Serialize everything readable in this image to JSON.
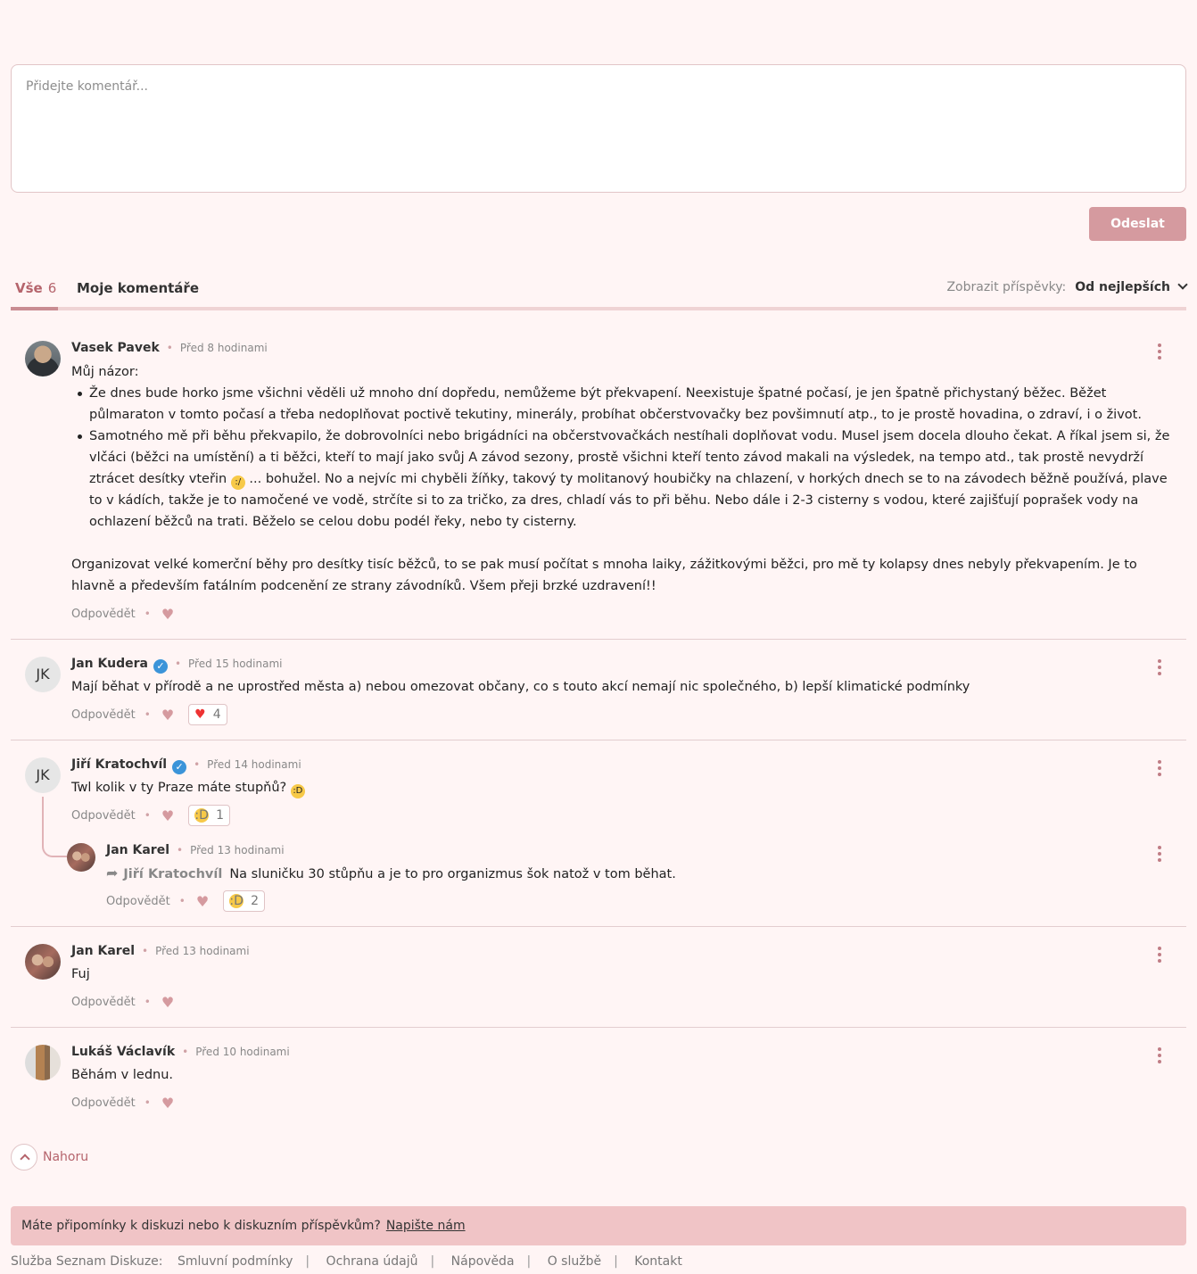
{
  "composer": {
    "placeholder": "Přidejte komentář..."
  },
  "send_label": "Odeslat",
  "tabs": {
    "all_label": "Vše",
    "all_count": "6",
    "mine_label": "Moje komentáře",
    "sort_label": "Zobrazit příspěvky:",
    "sort_value": "Od nejlepších"
  },
  "comments": [
    {
      "author": "Vasek Pavek",
      "time": "Před 8 hodinami",
      "intro": "Můj názor:",
      "bullets": [
        "Že dnes bude horko jsme všichni věděli už mnoho dní dopředu, nemůžeme být překvapení. Neexistuje špatné počasí, je jen špatně přichystaný běžec. Běžet půlmaraton v tomto počasí a třeba nedoplňovat poctivě tekutiny, minerály, probíhat občerstvovačky bez povšimnutí atp., to je prostě hovadina, o zdraví, i o život.",
        "Samotného mě při běhu překvapilo, že dobrovolníci nebo brigádníci na občerstvovačkách nestíhali doplňovat vodu. Musel jsem docela dlouho čekat. A říkal jsem si, že vlčáci (běžci na umístění) a ti běžci, kteří to mají jako svůj A závod sezony, prostě všichni kteří tento závod makali na výsledek, na tempo atd., tak prostě nevydrží ztrácet desítky vteřin",
        "... bohužel. No a nejvíc mi chyběli žíňky, takový ty molitanový houbičky na chlazení, v horkých dnech se to na závodech běžně používá, plave to v kádích, takže je to namočené ve vodě, strčíte si to za tričko, za dres, chladí vás to při běhu. Nebo dále i 2-3 cisterny s vodou, které zajišťují poprašek vody na ochlazení běžců na trati. Běželo se celou dobu podél řeky, nebo ty cisterny."
      ],
      "outro": "Organizovat velké komerční běhy pro desítky tisíc běžců, to se pak musí počítat s mnoha laiky, zážitkovými běžci, pro mě ty kolapsy dnes nebyly překvapením. Je to hlavně a především fatálním podcenění ze strany závodníků. Všem přeji brzké uzdravení!!",
      "reply": "Odpovědět"
    },
    {
      "author": "Jan Kudera",
      "initials": "JK",
      "time": "Před 15 hodinami",
      "text": "Mají běhat v přírodě a ne uprostřed města a) nebou omezovat občany, co s touto akcí nemají nic společného, b) lepší klimatické podmínky",
      "reply": "Odpovědět",
      "reaction_count": "4"
    },
    {
      "author": "Jiří Kratochvíl",
      "initials": "JK",
      "time": "Před 14 hodinami",
      "text": "Twl kolik v ty Praze máte stupňů?",
      "reply": "Odpovědět",
      "reaction_count": "1"
    },
    {
      "author": "Jan Karel",
      "time": "Před 13 hodinami",
      "reply_to": "Jiří Kratochvíl",
      "text": "Na sluničku 30 stůpňu a je to pro organizmus šok natož v tom běhat.",
      "reply": "Odpovědět",
      "reaction_count": "2"
    },
    {
      "author": "Jan Karel",
      "time": "Před 13 hodinami",
      "text": "Fuj",
      "reply": "Odpovědět"
    },
    {
      "author": "Lukáš Václavík",
      "time": "Před 10 hodinami",
      "text": "Běhám v lednu.",
      "reply": "Odpovědět"
    }
  ],
  "top_label": "Nahoru",
  "feedback": {
    "text": "Máte připomínky k diskuzi nebo k diskuzním příspěvkům?",
    "link": "Napište nám"
  },
  "footer": {
    "label": "Služba Seznam Diskuze:",
    "links": [
      "Smluvní podmínky",
      "Ochrana údajů",
      "Nápověda",
      "O službě",
      "Kontakt"
    ]
  },
  "colors": {
    "accent": "#b5646c",
    "button": "#d59a9f",
    "background": "#fff5f5",
    "banner": "#f0c4c6"
  },
  "icons": [
    "heart-icon",
    "more-vertical-icon",
    "verified-icon",
    "reply-arrow-icon",
    "chevron-down-icon",
    "chevron-up-icon"
  ]
}
